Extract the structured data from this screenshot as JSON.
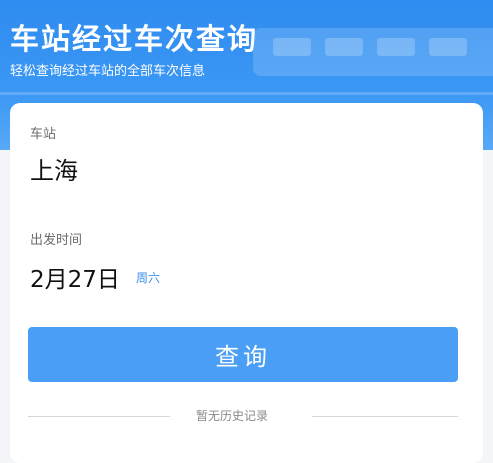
{
  "header": {
    "title": "车站经过车次查询",
    "subtitle": "轻松查询经过车站的全部车次信息"
  },
  "form": {
    "station_label": "车站",
    "station_value": "上海",
    "date_label": "出发时间",
    "date_value": "2月27日",
    "weekday": "周六",
    "search_label": "查询"
  },
  "history": {
    "empty_text": "暂无历史记录"
  },
  "colors": {
    "header_blue": "#3a97f4",
    "button_blue": "#4a9ef5",
    "link_blue": "#3a8ff0"
  }
}
